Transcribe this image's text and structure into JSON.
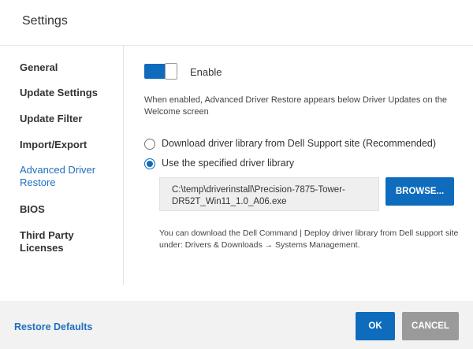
{
  "window": {
    "title": "Settings"
  },
  "sidebar": {
    "items": [
      {
        "label": "General"
      },
      {
        "label": "Update Settings"
      },
      {
        "label": "Update Filter"
      },
      {
        "label": "Import/Export"
      },
      {
        "label": "Advanced Driver Restore",
        "active": true
      },
      {
        "label": "BIOS"
      },
      {
        "label": "Third Party Licenses"
      }
    ]
  },
  "content": {
    "toggle": {
      "label": "Enable",
      "state": "on"
    },
    "description": "When enabled, Advanced Driver Restore appears below Driver Updates on the Welcome screen",
    "options": [
      {
        "label": "Download driver library from Dell Support site (Recommended)",
        "checked": false
      },
      {
        "label": "Use the specified driver library",
        "checked": true
      }
    ],
    "path_value": "C:\\temp\\driverinstall\\Precision-7875-Tower-DR52T_Win11_1.0_A06.exe",
    "browse_label": "BROWSE...",
    "note": "You can download the Dell Command | Deploy driver library from Dell support site under: Drivers & Downloads → Systems Management."
  },
  "footer": {
    "restore_label": "Restore Defaults",
    "ok_label": "OK",
    "cancel_label": "CANCEL"
  },
  "colors": {
    "accent": "#0f6cbd",
    "link": "#1f6fbe",
    "cancel": "#9a9a9a",
    "footer_bg": "#f2f2f2"
  }
}
